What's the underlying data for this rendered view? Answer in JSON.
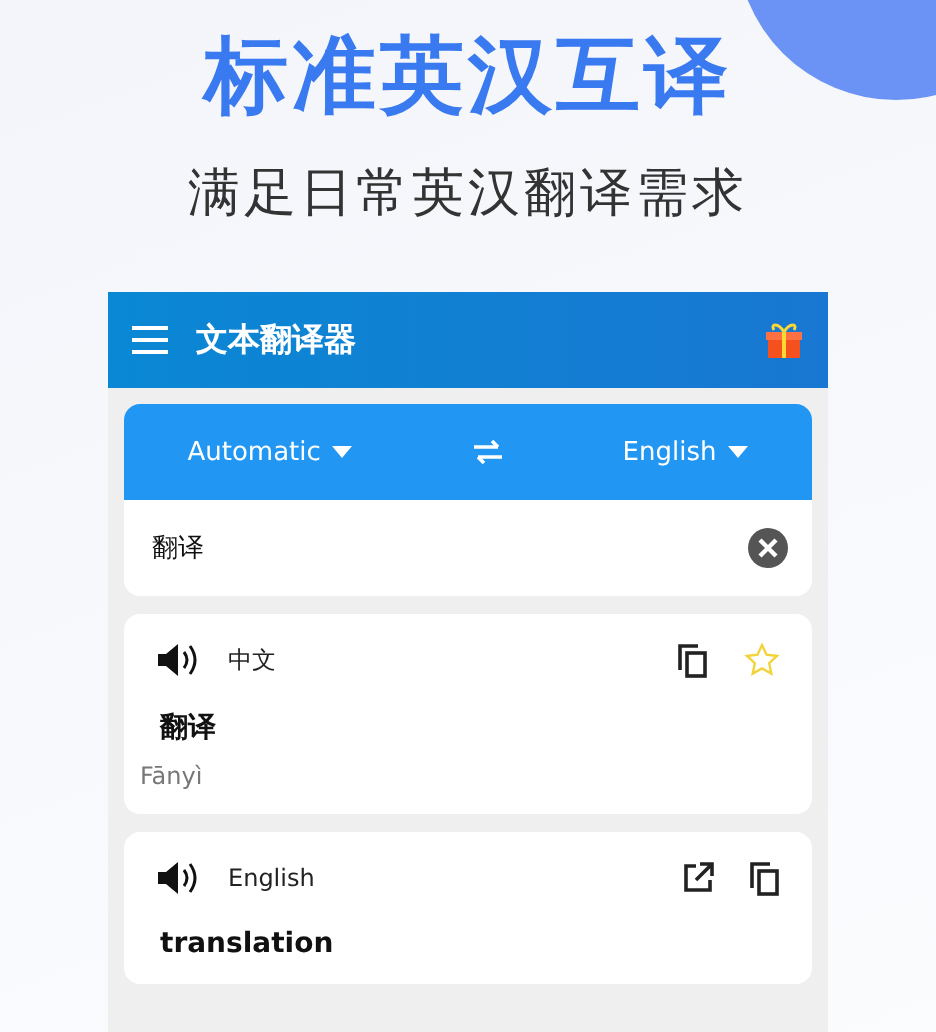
{
  "promo": {
    "headline": "标准英汉互译",
    "subtitle": "满足日常英汉翻译需求"
  },
  "app_bar": {
    "title": "文本翻译器"
  },
  "language_bar": {
    "source": "Automatic",
    "target": "English"
  },
  "input": {
    "value": "翻译"
  },
  "results": [
    {
      "kind": "source",
      "language": "中文",
      "text": "翻译",
      "romanization": "Fānyì",
      "starred": false
    },
    {
      "kind": "target",
      "language": "English",
      "text": "translation"
    }
  ]
}
